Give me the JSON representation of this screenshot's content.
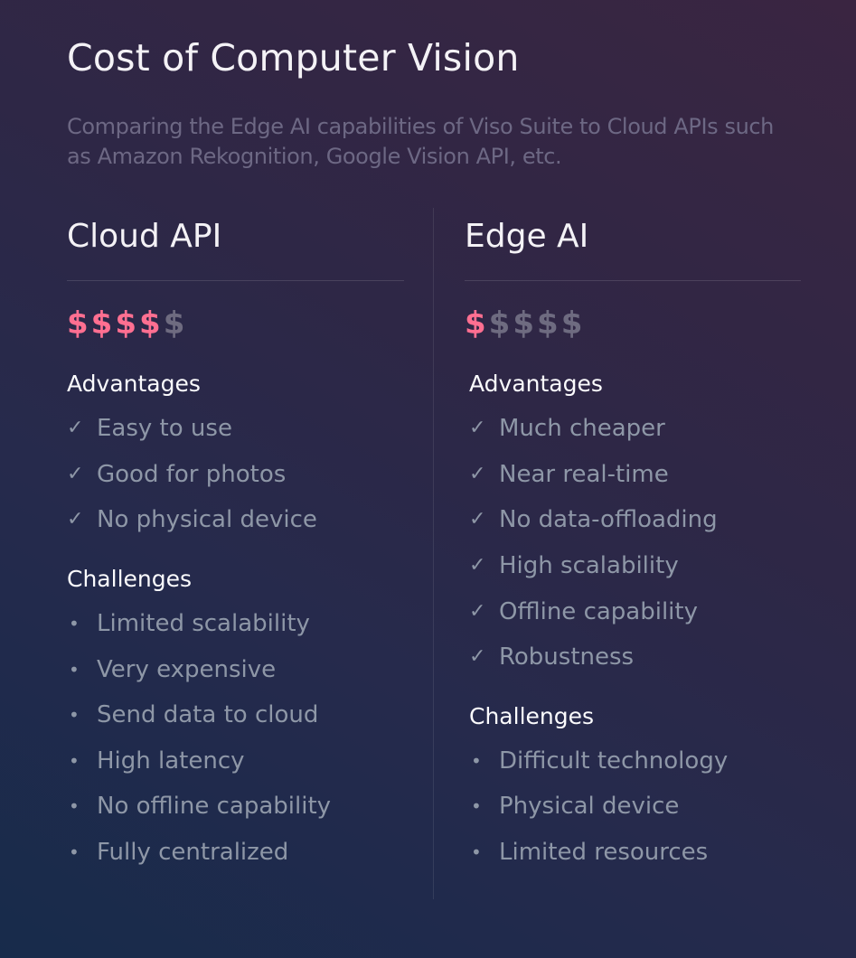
{
  "header": {
    "title": "Cost of Computer Vision",
    "subtitle": "Comparing the Edge AI capabilities of Viso Suite to Cloud APIs such as Amazon Rekognition, Google Vision API, etc."
  },
  "colors": {
    "price_active": "#ff6f91",
    "price_inactive": "#6e6b80",
    "item_text": "#8e97a7",
    "subtitle_text": "#6d6884"
  },
  "columns": [
    {
      "title": "Cloud API",
      "price": {
        "symbol": "$",
        "active": 4,
        "total": 5
      },
      "advantages_label": "Advantages",
      "advantages": [
        "Easy to use",
        "Good for photos",
        "No physical device"
      ],
      "challenges_label": "Challenges",
      "challenges": [
        "Limited scalability",
        "Very expensive",
        "Send data to cloud",
        "High latency",
        "No offline capability",
        "Fully centralized"
      ]
    },
    {
      "title": "Edge AI",
      "price": {
        "symbol": "$",
        "active": 1,
        "total": 5
      },
      "advantages_label": "Advantages",
      "advantages": [
        "Much cheaper",
        "Near real-time",
        "No data-offloading",
        "High scalability",
        "Offline capability",
        "Robustness"
      ],
      "challenges_label": "Challenges",
      "challenges": [
        "Difficult technology",
        "Physical device",
        "Limited resources"
      ]
    }
  ],
  "icons": {
    "advantage": "✓",
    "challenge": "•"
  }
}
